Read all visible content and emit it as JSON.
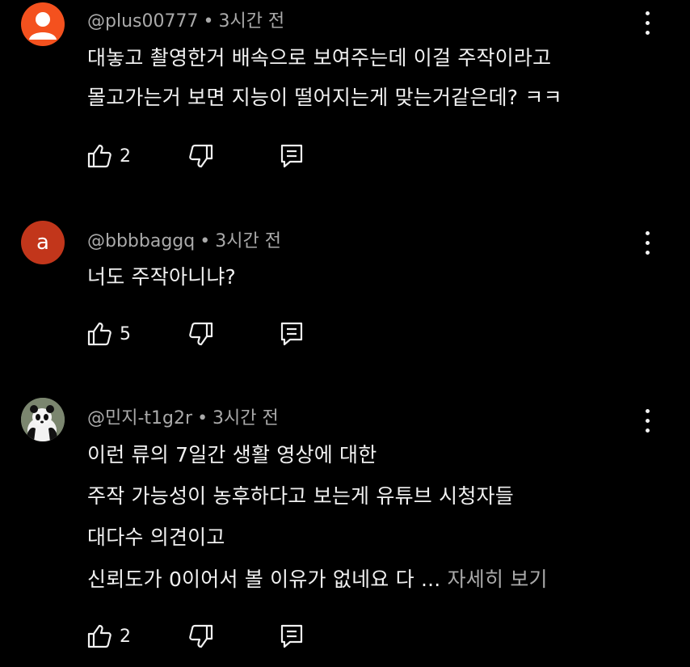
{
  "comments": [
    {
      "handle": "@plus00777",
      "sep": "•",
      "time": "3시간 전",
      "lines": [
        "대놓고 촬영한거 배속으로 보여주는데 이걸 주작이라고",
        "몰고가는거 보면 지능이 떨어지는게 맞는거같은데? ㅋㅋ"
      ],
      "likes": "2"
    },
    {
      "handle": "@bbbbaggq",
      "sep": "•",
      "time": "3시간 전",
      "avatar_letter": "a",
      "lines": [
        "너도 주작아니냐?"
      ],
      "likes": "5"
    },
    {
      "handle": "@민지-t1g2r",
      "sep": "•",
      "time": "3시간 전",
      "lines": [
        "이런 류의 7일간 생활 영상에 대한",
        "주작 가능성이 농후하다고 보는게 유튜브 시청자들",
        "대다수 의견이고",
        "신뢰도가 0이어서 볼 이유가 없네요 다 ..."
      ],
      "read_more": "자세히 보기",
      "likes": "2"
    }
  ],
  "icons": {
    "like": "thumbs-up-icon",
    "dislike": "thumbs-down-icon",
    "reply": "reply-icon",
    "menu": "more-vert-icon"
  }
}
